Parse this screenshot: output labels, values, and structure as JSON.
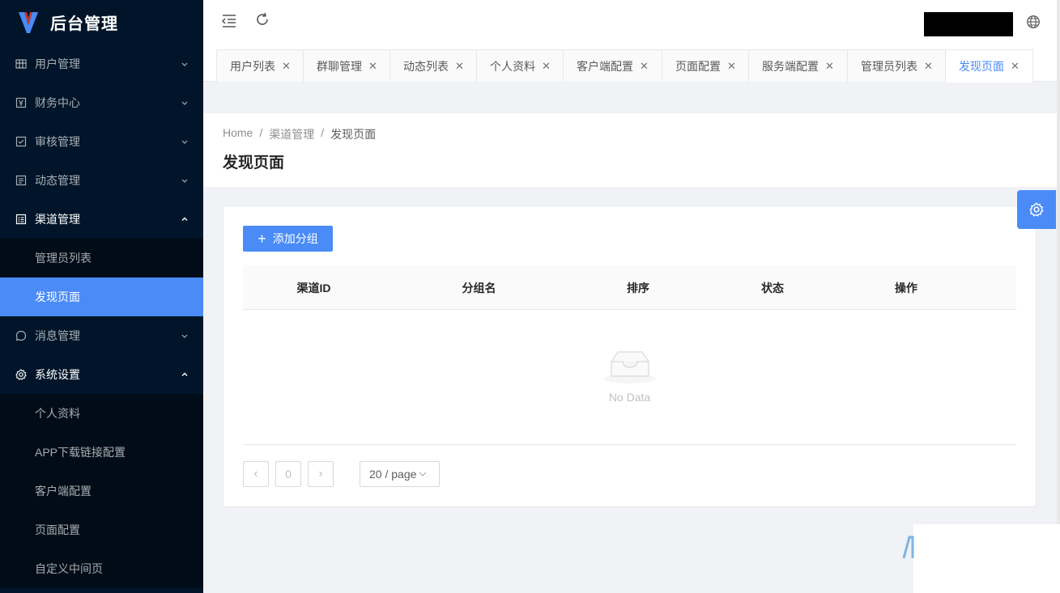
{
  "app": {
    "title": "后台管理"
  },
  "sidebar": {
    "groups": [
      {
        "label": "用户管理",
        "icon": "table-icon",
        "open": false
      },
      {
        "label": "财务中心",
        "icon": "currency-icon",
        "open": false
      },
      {
        "label": "审核管理",
        "icon": "check-square-icon",
        "open": false
      },
      {
        "label": "动态管理",
        "icon": "file-list-icon",
        "open": false
      },
      {
        "label": "渠道管理",
        "icon": "profile-icon",
        "open": true,
        "children": [
          {
            "label": "管理员列表"
          },
          {
            "label": "发现页面",
            "active": true
          }
        ]
      },
      {
        "label": "消息管理",
        "icon": "message-icon",
        "open": false
      },
      {
        "label": "系统设置",
        "icon": "setting-icon",
        "open": true,
        "children": [
          {
            "label": "个人资料"
          },
          {
            "label": "APP下载链接配置"
          },
          {
            "label": "客户端配置"
          },
          {
            "label": "页面配置"
          },
          {
            "label": "自定义中间页"
          }
        ]
      }
    ]
  },
  "tabs": [
    {
      "label": "用户列表"
    },
    {
      "label": "群聊管理"
    },
    {
      "label": "动态列表"
    },
    {
      "label": "个人资料"
    },
    {
      "label": "客户端配置"
    },
    {
      "label": "页面配置"
    },
    {
      "label": "服务端配置"
    },
    {
      "label": "管理员列表"
    },
    {
      "label": "发现页面",
      "active": true
    }
  ],
  "breadcrumb": [
    "Home",
    "渠道管理",
    "发现页面"
  ],
  "page": {
    "title": "发现页面"
  },
  "toolbar": {
    "add_label": "添加分组"
  },
  "table": {
    "columns": [
      "渠道ID",
      "分组名",
      "排序",
      "状态",
      "操作"
    ],
    "rows": [],
    "empty_text": "No Data"
  },
  "pagination": {
    "current": "0",
    "page_size": "20 / page"
  },
  "colors": {
    "primary": "#4a8bf7",
    "sidebar_bg": "#001529",
    "submenu_bg": "#000c17"
  }
}
